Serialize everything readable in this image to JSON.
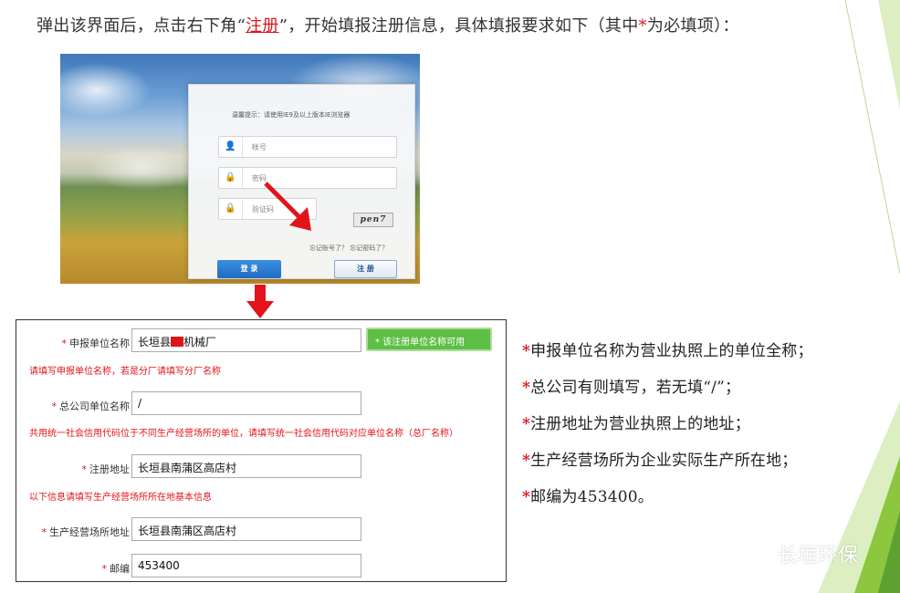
{
  "instruction": {
    "before": "弹出该界面后，点击右下角“",
    "link": "注册",
    "middle": "”，开始填报注册信息，具体填报要求如下（其中",
    "star": "*",
    "after": "为必填项）："
  },
  "login": {
    "tip": "温馨提示：请使用IE9及以上版本IE浏览器",
    "account_placeholder": "帐号",
    "password_placeholder": "密码",
    "captcha_placeholder": "验证码",
    "captcha_text": "pen7",
    "forgot_text": "忘记账号了？  忘记密码了？",
    "login_button": "登 录",
    "register_button": "注 册",
    "account_icon": "user-icon",
    "lock_icon": "lock-icon"
  },
  "form": {
    "unit_name": {
      "required_mark": "*",
      "label": "申报单位名称",
      "value_prefix": "长垣县",
      "value_suffix": "机械厂",
      "validation": "* 该注册单位名称可用",
      "note": "请填写申报单位名称，若是分厂请填写分厂名称"
    },
    "parent_company": {
      "required_mark": "*",
      "label": "总公司单位名称",
      "value": "/",
      "note": "共用统一社会信用代码位于不同生产经营场所的单位，请填写统一社会信用代码对应单位名称（总厂名称）"
    },
    "registered_address": {
      "required_mark": "*",
      "label": "注册地址",
      "value": "长垣县南蒲区高店村",
      "note": "以下信息请填写生产经营场所所在地基本信息"
    },
    "business_address": {
      "required_mark": "*",
      "label": "生产经营场所地址",
      "value": "长垣县南蒲区高店村"
    },
    "postcode": {
      "required_mark": "*",
      "label": "邮编",
      "value": "453400"
    }
  },
  "notes": [
    {
      "star": "*",
      "text": "申报单位名称为营业执照上的单位全称；"
    },
    {
      "star": "*",
      "text": "总公司有则填写，若无填“/”；"
    },
    {
      "star": "*",
      "text": "注册地址为营业执照上的地址；"
    },
    {
      "star": "*",
      "text": "生产经营场所为企业实际生产所在地；"
    },
    {
      "star": "*",
      "text": "邮编为453400。"
    }
  ],
  "watermark": {
    "text": "长垣环保",
    "icon": "wechat-icon"
  },
  "colors": {
    "accent_red": "#d9151b",
    "valid_green": "#5ebf45",
    "login_blue": "#1f6bc2",
    "deco_green": "#8dc63f"
  }
}
